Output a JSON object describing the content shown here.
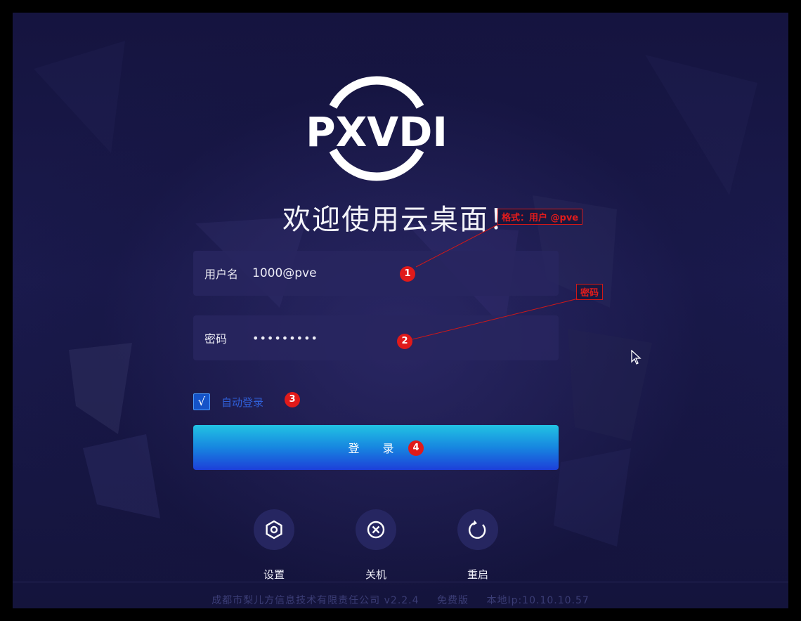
{
  "logo": {
    "text": "PXVDI"
  },
  "welcome": "欢迎使用云桌面！",
  "username": {
    "label": "用户名",
    "value": "1000@pve"
  },
  "password": {
    "label": "密码",
    "value": "•••••••••"
  },
  "auto_login": {
    "checked": true,
    "check_mark": "√",
    "label": "自动登录"
  },
  "login_button": "登  录",
  "actions": [
    {
      "label": "设置",
      "icon": "gear-icon"
    },
    {
      "label": "关机",
      "icon": "close-circle-icon"
    },
    {
      "label": "重启",
      "icon": "restart-icon"
    }
  ],
  "footer": {
    "company": "成都市梨儿方信息技术有限责任公司 v2.2.4",
    "edition": "免费版",
    "ip": "本地Ip:10.10.10.57"
  },
  "annotations": {
    "badges": [
      "1",
      "2",
      "3",
      "4"
    ],
    "note_username": "格式：用户 @pve",
    "note_password": "密码"
  },
  "colors": {
    "accent": "#1d3fd9",
    "annotation": "#e01a1a",
    "background": "#1a1a4d"
  }
}
